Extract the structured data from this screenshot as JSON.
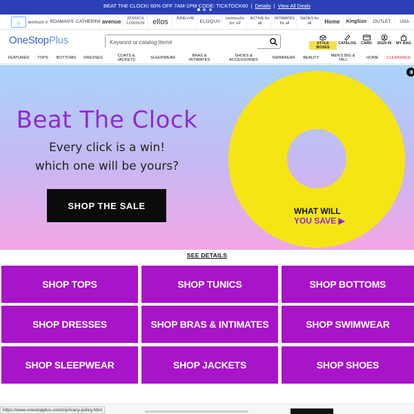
{
  "promo": {
    "text": "BEAT THE CLOCK! 60% OFF 7AM-1PM CODE: TICKTOCK60",
    "separator": "|",
    "details": "Details",
    "view_all": "View All Deals"
  },
  "brands": {
    "home_icon": "home-icon",
    "items": [
      "woman within",
      "ROAMAN'S",
      "CATHERINES",
      "avenue",
      "JESSICA LONDON",
      "ellos",
      "JUNE+VIE",
      "ELOQUII",
      "swimsuits for all",
      "ACTIVE for all",
      "INTIMATES for all",
      "SHOES for all",
      "Home",
      "KingSize",
      "OUTLET",
      "USA"
    ]
  },
  "header": {
    "logo_main": "OneStop",
    "logo_plus": "Plus",
    "search_placeholder": "Keyword or catalog item#",
    "utils": {
      "style_boxes": "STYLE BOXES",
      "catalog": "CATALOG",
      "card": "CARD",
      "sign_in": "SIGN IN",
      "my_bag": "MY BAG"
    }
  },
  "nav": {
    "items": [
      "FEATURED",
      "TOPS",
      "BOTTOMS",
      "DRESSES",
      "COATS & JACKETS",
      "SLEEPWEAR",
      "BRAS & INTIMATES",
      "SHOES & ACCESSORIES",
      "SWIMWEAR",
      "BEAUTY",
      "MEN'S BIG & TALL",
      "HOME",
      "CLEARANCE"
    ],
    "clearance_color": "#d7263d"
  },
  "hero": {
    "title": "Beat The Clock",
    "line1": "Every click is a win!",
    "line2": "which one will be yours?",
    "cta": "SHOP THE SALE",
    "ring_line1": "WHAT WILL",
    "ring_line2": "YOU SAVE",
    "ring_color": "#f6e514",
    "title_color": "#8e2ad1"
  },
  "details_link": "SEE DETAILS",
  "tiles": [
    "SHOP TOPS",
    "SHOP TUNICS",
    "SHOP BOTTOMS",
    "SHOP DRESSES",
    "SHOP BRAS & INTIMATES",
    "SHOP SWIMWEAR",
    "SHOP SLEEPWEAR",
    "SHOP JACKETS",
    "SHOP SHOES"
  ],
  "tile_color": "#a714c9",
  "status_url": "https://www.onestopplus.com/c/privacy-policy.html"
}
